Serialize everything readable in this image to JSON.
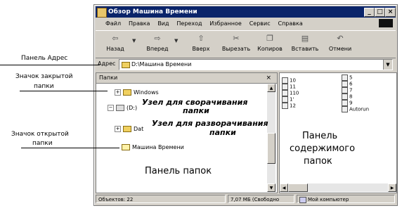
{
  "window": {
    "title": "Обзор Машина Времени",
    "min_label": "_",
    "max_label": "□",
    "close_label": "×"
  },
  "menu": [
    "Файл",
    "Правка",
    "Вид",
    "Переход",
    "Избранное",
    "Сервис",
    "Справка"
  ],
  "toolbar": {
    "back": "Назад",
    "forward": "Вперед",
    "up": "Вверх",
    "cut": "Вырезать",
    "copy": "Копиров",
    "paste": "Вставить",
    "undo": "Отмени"
  },
  "address": {
    "label": "Адрес",
    "value": "D:\\Машина Времени"
  },
  "folders": {
    "header": "Папки",
    "close": "×",
    "items": [
      "Windows",
      "(D:)",
      "Dat",
      "Машина Времени"
    ]
  },
  "contents": {
    "left_items": [
      "10",
      "11",
      "110",
      "1'",
      "12"
    ],
    "right_items": [
      "5",
      "6",
      "7",
      "8",
      "9",
      "Autorun"
    ]
  },
  "status": {
    "objects": "Объектов: 22",
    "size": "7,07 МБ (Свободно",
    "location": "Мой компьютер"
  },
  "annotations": {
    "address_panel": "Панель Адрес",
    "closed_folder_icon_1": "Значок закрытой",
    "closed_folder_icon_2": "папки",
    "collapse_node_1": "Узел для сворачивания",
    "collapse_node_2": "папки",
    "expand_node_1": "Узел для разворачивания",
    "expand_node_2": "папки",
    "open_folder_icon_1": "Значок открытой",
    "open_folder_icon_2": "папки",
    "folders_panel": "Панель папок",
    "contents_panel_1": "Панель",
    "contents_panel_2": "содержимого",
    "contents_panel_3": "папок"
  }
}
